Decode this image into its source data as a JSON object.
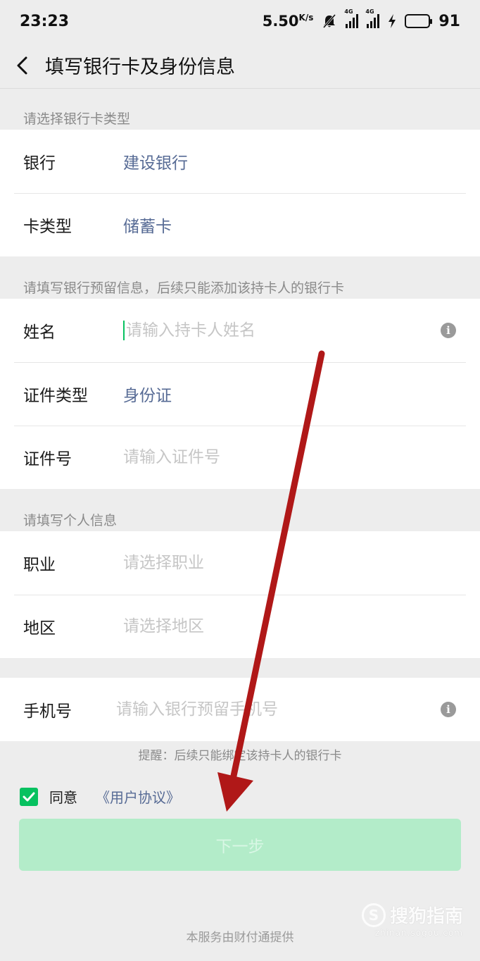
{
  "status_bar": {
    "time": "23:23",
    "speed_value": "5.50",
    "speed_unit": "K/s",
    "network_label": "4G",
    "battery": "91",
    "battery_level": 0.91,
    "battery_color": "#20c020"
  },
  "nav": {
    "back_icon": "chevron-left-icon",
    "title": "填写银行卡及身份信息"
  },
  "section_bank": {
    "label": "请选择银行卡类型",
    "rows": [
      {
        "label": "银行",
        "value": "建设银行"
      },
      {
        "label": "卡类型",
        "value": "储蓄卡"
      }
    ]
  },
  "section_id": {
    "label": "请填写银行预留信息，后续只能添加该持卡人的银行卡",
    "name_label": "姓名",
    "name_placeholder": "请输入持卡人姓名",
    "id_type_label": "证件类型",
    "id_type_value": "身份证",
    "id_number_label": "证件号",
    "id_number_placeholder": "请输入证件号"
  },
  "section_personal": {
    "label": "请填写个人信息",
    "occupation_label": "职业",
    "occupation_placeholder": "请选择职业",
    "region_label": "地区",
    "region_placeholder": "请选择地区"
  },
  "section_phone": {
    "phone_label": "手机号",
    "phone_placeholder": "请输入银行预留手机号"
  },
  "hint": "提醒：后续只能绑定该持卡人的银行卡",
  "agreement": {
    "checked": true,
    "agree_text": "同意",
    "link_text": "《用户协议》"
  },
  "next_button": "下一步",
  "footer": "本服务由财付通提供",
  "watermark": {
    "logo_letter": "S",
    "text": "搜狗指南",
    "url": "zhinan.sogou.com"
  },
  "colors": {
    "accent": "#07c160",
    "link": "#576b95",
    "button_disabled": "#b3ecc9",
    "arrow": "#b01818"
  }
}
